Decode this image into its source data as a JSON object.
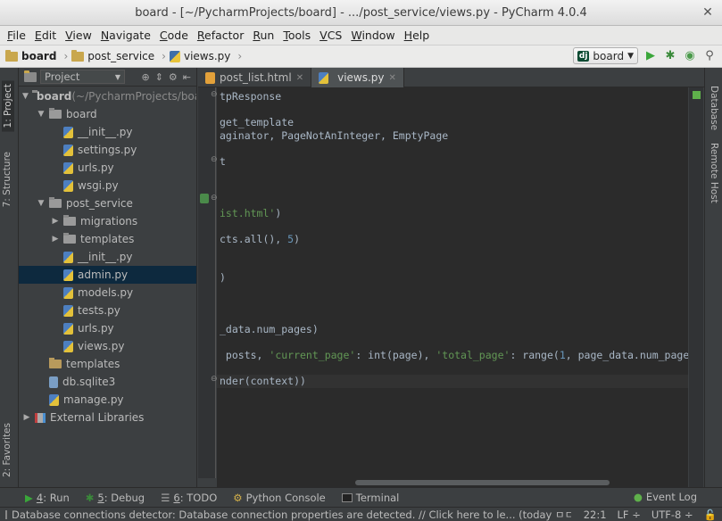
{
  "window": {
    "title": "board - [~/PycharmProjects/board] - .../post_service/views.py - PyCharm 4.0.4"
  },
  "menu": [
    "File",
    "Edit",
    "View",
    "Navigate",
    "Code",
    "Refactor",
    "Run",
    "Tools",
    "VCS",
    "Window",
    "Help"
  ],
  "breadcrumb": [
    "board",
    "post_service",
    "views.py"
  ],
  "run_config": "board",
  "left_tabs": {
    "project": "1: Project",
    "structure": "7: Structure",
    "favorites": "2: Favorites"
  },
  "right_tabs": {
    "database": "Database",
    "remote": "Remote Host"
  },
  "project_panel": {
    "view_label": "Project"
  },
  "tree": [
    {
      "label": "board",
      "suffix": " (~/PycharmProjects/boar",
      "depth": 0,
      "arrow": "▼",
      "icon": "folder",
      "bold": true
    },
    {
      "label": "board",
      "depth": 1,
      "arrow": "▼",
      "icon": "pkg"
    },
    {
      "label": "__init__.py",
      "depth": 2,
      "arrow": "",
      "icon": "py"
    },
    {
      "label": "settings.py",
      "depth": 2,
      "arrow": "",
      "icon": "py"
    },
    {
      "label": "urls.py",
      "depth": 2,
      "arrow": "",
      "icon": "py"
    },
    {
      "label": "wsgi.py",
      "depth": 2,
      "arrow": "",
      "icon": "py"
    },
    {
      "label": "post_service",
      "depth": 1,
      "arrow": "▼",
      "icon": "pkg"
    },
    {
      "label": "migrations",
      "depth": 2,
      "arrow": "▶",
      "icon": "pkg"
    },
    {
      "label": "templates",
      "depth": 2,
      "arrow": "▶",
      "icon": "pkg"
    },
    {
      "label": "__init__.py",
      "depth": 2,
      "arrow": "",
      "icon": "py"
    },
    {
      "label": "admin.py",
      "depth": 2,
      "arrow": "",
      "icon": "py",
      "selected": true
    },
    {
      "label": "models.py",
      "depth": 2,
      "arrow": "",
      "icon": "py"
    },
    {
      "label": "tests.py",
      "depth": 2,
      "arrow": "",
      "icon": "py"
    },
    {
      "label": "urls.py",
      "depth": 2,
      "arrow": "",
      "icon": "py"
    },
    {
      "label": "views.py",
      "depth": 2,
      "arrow": "",
      "icon": "py"
    },
    {
      "label": "templates",
      "depth": 1,
      "arrow": "",
      "icon": "plain"
    },
    {
      "label": "db.sqlite3",
      "depth": 1,
      "arrow": "",
      "icon": "db"
    },
    {
      "label": "manage.py",
      "depth": 1,
      "arrow": "",
      "icon": "py"
    },
    {
      "label": "External Libraries",
      "depth": 0,
      "arrow": "▶",
      "icon": "lib"
    }
  ],
  "editor_tabs": [
    {
      "label": "post_list.html",
      "icon": "html",
      "active": false
    },
    {
      "label": "views.py",
      "icon": "py",
      "active": true
    }
  ],
  "code": [
    {
      "line": 0,
      "text": "tpResponse"
    },
    {
      "line": 2,
      "text": "get_template"
    },
    {
      "line": 3,
      "text": "aginator, PageNotAnInteger, EmptyPage"
    },
    {
      "line": 5,
      "text": "t"
    },
    {
      "line": 9,
      "parts": [
        [
          "str",
          "ist.html'"
        ],
        [
          "",
          ")"
        ]
      ]
    },
    {
      "line": 11,
      "parts": [
        [
          "",
          "cts.all(), "
        ],
        [
          "num",
          "5"
        ],
        [
          "",
          ")"
        ]
      ]
    },
    {
      "line": 14,
      "text": ")"
    },
    {
      "line": 18,
      "text": "_data.num_pages)"
    },
    {
      "line": 20,
      "parts": [
        [
          "",
          " posts, "
        ],
        [
          "str",
          "'current_page'"
        ],
        [
          "",
          ": int(page), "
        ],
        [
          "str",
          "'total_page'"
        ],
        [
          "",
          ": range("
        ],
        [
          "num",
          "1"
        ],
        [
          "",
          ", page_data.num_pages + "
        ],
        [
          "num",
          "1"
        ],
        [
          "",
          ")"
        ]
      ]
    },
    {
      "line": 22,
      "text": "nder(context))",
      "highlight": true
    }
  ],
  "bottom_tools": [
    {
      "key": "4",
      "label": ": Run",
      "icon": "run"
    },
    {
      "key": "5",
      "label": ": Debug",
      "icon": "debug"
    },
    {
      "key": "6",
      "label": ": TODO",
      "icon": "todo"
    },
    {
      "key": "",
      "label": "Python Console",
      "icon": "console"
    },
    {
      "key": "",
      "label": "Terminal",
      "icon": "terminal"
    }
  ],
  "event_log": "Event Log",
  "status": {
    "message": "Database connections detector: Database connection properties are detected. // Click here to le... (today ㅁㅁ 10:00)",
    "position": "22:1",
    "line_sep": "LF ÷",
    "encoding": "UTF-8 ÷"
  },
  "colors": {
    "editor_bg": "#2b2b2b",
    "panel_bg": "#3c3f41",
    "selection": "#0d293e",
    "string": "#629755",
    "number": "#6897bb"
  }
}
